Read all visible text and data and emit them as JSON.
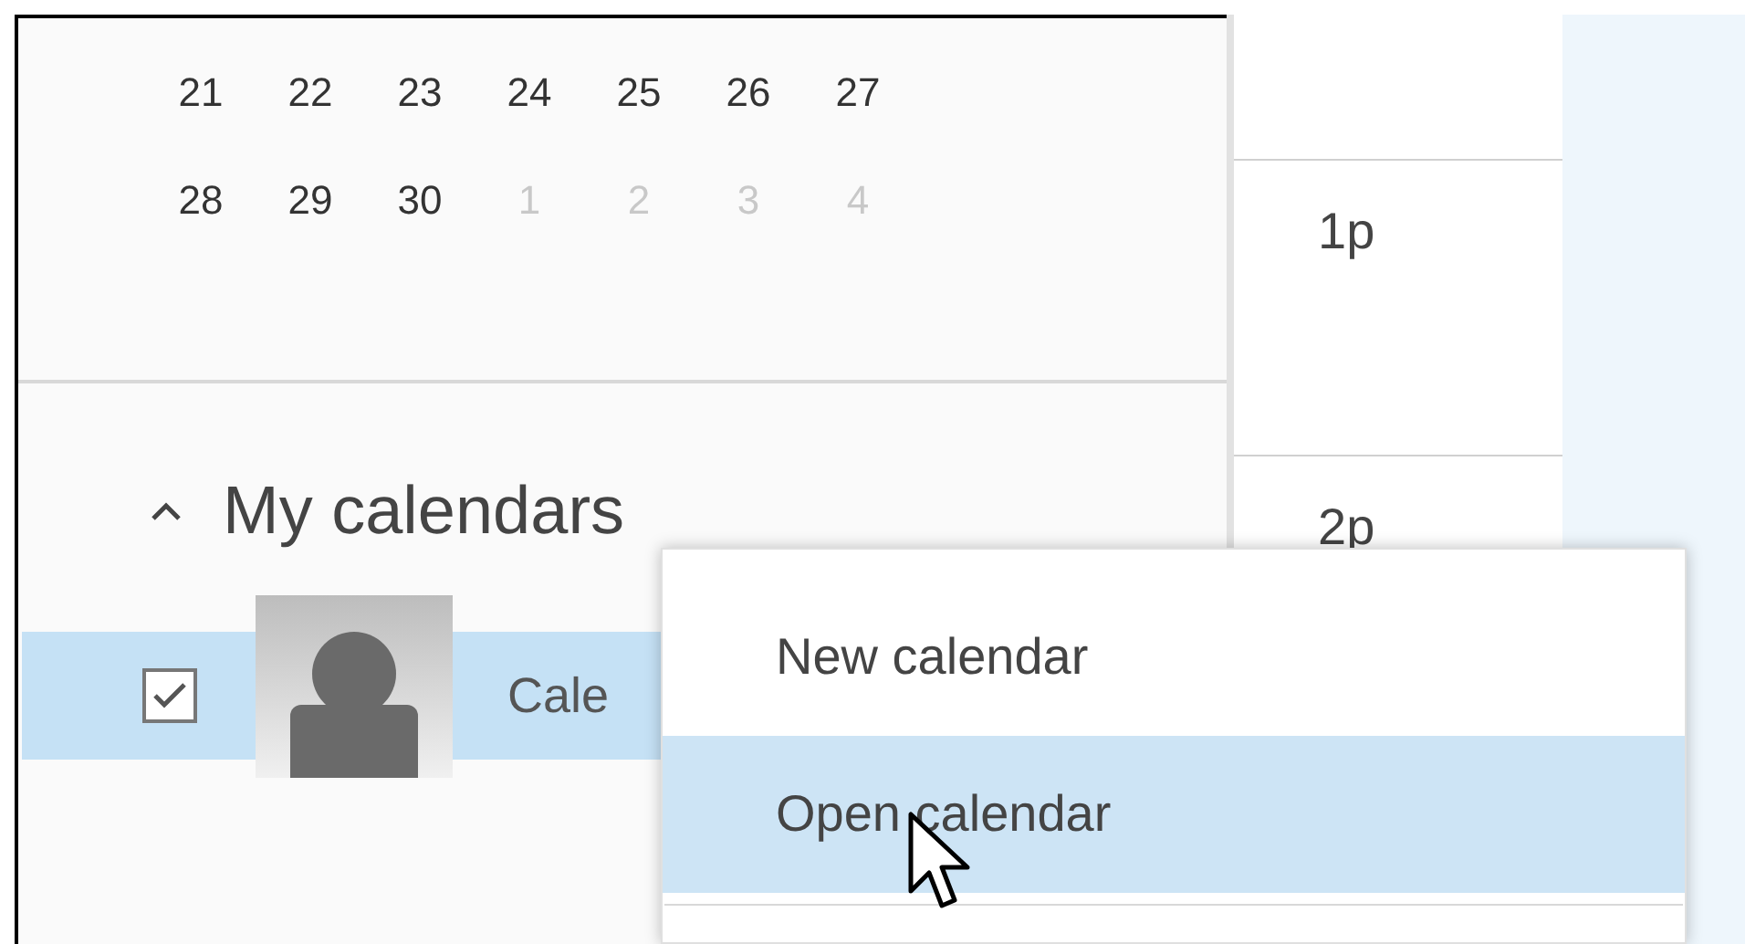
{
  "mini_calendar": {
    "weeks": [
      [
        {
          "day": "21",
          "other_month": false
        },
        {
          "day": "22",
          "other_month": false
        },
        {
          "day": "23",
          "other_month": false
        },
        {
          "day": "24",
          "other_month": false
        },
        {
          "day": "25",
          "other_month": false
        },
        {
          "day": "26",
          "other_month": false
        },
        {
          "day": "27",
          "other_month": false
        }
      ],
      [
        {
          "day": "28",
          "other_month": false
        },
        {
          "day": "29",
          "other_month": false
        },
        {
          "day": "30",
          "other_month": false
        },
        {
          "day": "1",
          "other_month": true
        },
        {
          "day": "2",
          "other_month": true
        },
        {
          "day": "3",
          "other_month": true
        },
        {
          "day": "4",
          "other_month": true
        }
      ]
    ]
  },
  "my_calendars": {
    "title": "My calendars",
    "expanded": true,
    "items": [
      {
        "name": "Cale",
        "checked": true,
        "selected": true
      }
    ]
  },
  "time_slots": [
    "1p",
    "2p"
  ],
  "context_menu": {
    "items": [
      {
        "label": "New calendar",
        "selected": false
      },
      {
        "label": "Open calendar",
        "selected": true
      }
    ]
  }
}
